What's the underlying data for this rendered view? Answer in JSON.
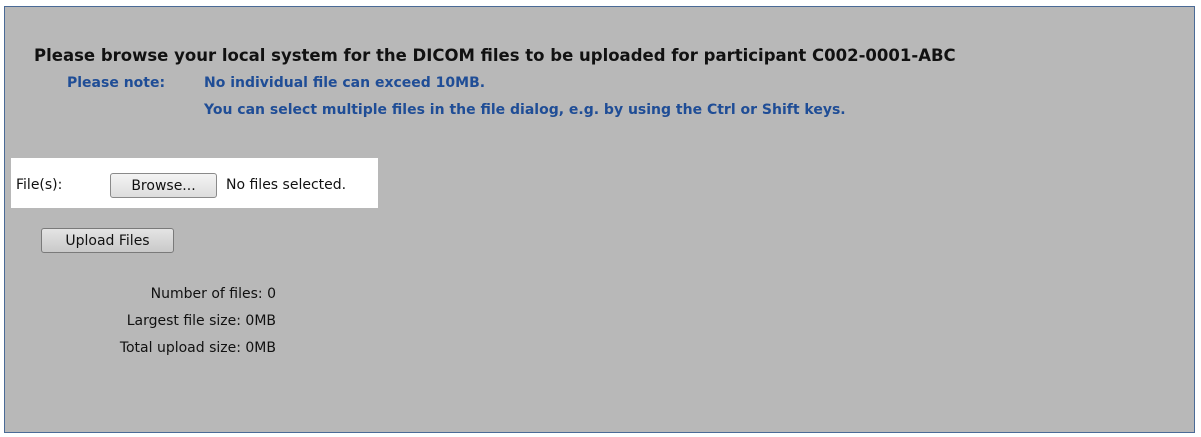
{
  "title": "Please browse your local system for the DICOM files to be uploaded for participant C002-0001-ABC",
  "note": {
    "label": "Please note:",
    "lines": [
      "No individual file can exceed 10MB.",
      "You can select multiple files in the file dialog, e.g. by using the Ctrl or Shift keys."
    ]
  },
  "file_input": {
    "label": "File(s):",
    "browse_label": "Browse...",
    "status": "No files selected."
  },
  "upload_button_label": "Upload Files",
  "stats": [
    "Number of files: 0",
    "Largest file size: 0MB",
    "Total upload size: 0MB"
  ],
  "colors": {
    "panel_background": "#b8b8b8",
    "panel_border": "#4a6a96",
    "note_text": "#1f4d96",
    "file_row_highlight": "#ffffff"
  }
}
